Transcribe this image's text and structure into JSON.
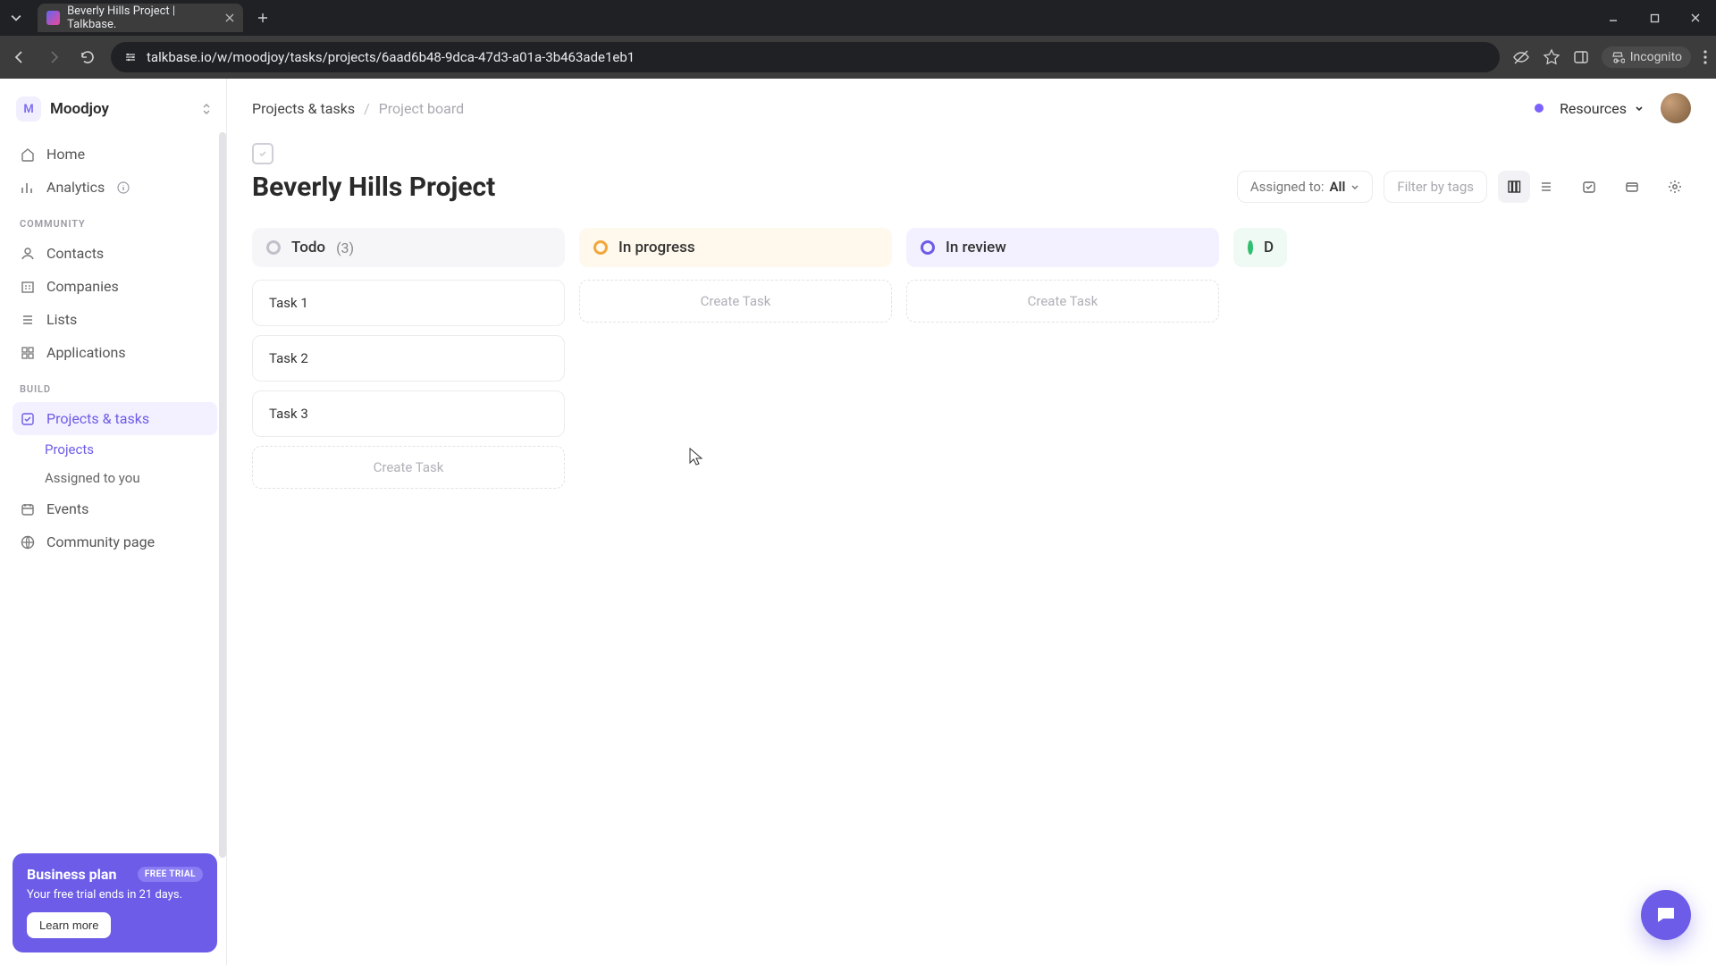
{
  "browser": {
    "tab_title": "Beverly Hills Project | Talkbase.",
    "url": "talkbase.io/w/moodjoy/tasks/projects/6aad6b48-9dca-47d3-a01a-3b463ade1eb1",
    "incognito_label": "Incognito"
  },
  "workspace": {
    "initial": "M",
    "name": "Moodjoy"
  },
  "sidebar": {
    "home": "Home",
    "analytics": "Analytics",
    "section_community": "COMMUNITY",
    "contacts": "Contacts",
    "companies": "Companies",
    "lists": "Lists",
    "applications": "Applications",
    "section_build": "BUILD",
    "projects_tasks": "Projects & tasks",
    "sub_projects": "Projects",
    "sub_assigned": "Assigned to you",
    "events": "Events",
    "community_page": "Community page"
  },
  "promo": {
    "title": "Business plan",
    "badge": "FREE TRIAL",
    "text": "Your free trial ends in 21 days.",
    "cta": "Learn more"
  },
  "breadcrumb": {
    "root": "Projects & tasks",
    "current": "Project board"
  },
  "resources_label": "Resources",
  "project": {
    "title": "Beverly Hills Project"
  },
  "toolbar": {
    "assigned_prefix": "Assigned to:",
    "assigned_value": "All",
    "filter_placeholder": "Filter by tags"
  },
  "columns": [
    {
      "name": "Todo",
      "count": "(3)",
      "style": "todo",
      "tasks": [
        "Task 1",
        "Task 2",
        "Task 3"
      ],
      "create": "Create Task"
    },
    {
      "name": "In progress",
      "style": "inprog",
      "tasks": [],
      "create": "Create Task"
    },
    {
      "name": "In review",
      "style": "inrev",
      "tasks": [],
      "create": "Create Task"
    },
    {
      "name": "D",
      "style": "done",
      "partial": true
    }
  ]
}
